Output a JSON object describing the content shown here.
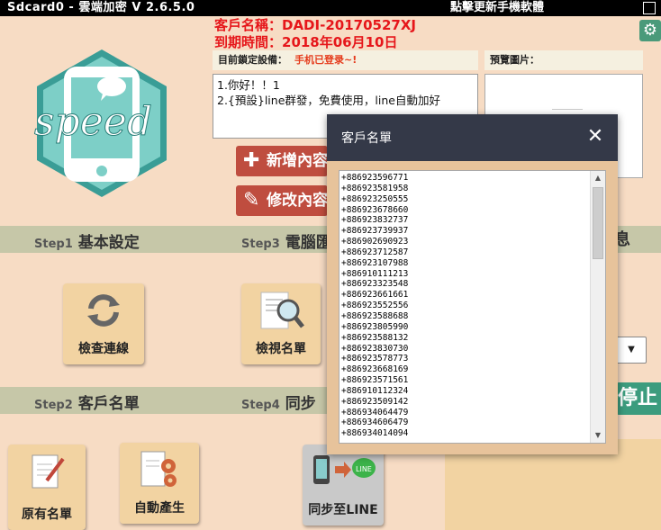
{
  "titlebar": {
    "title": "Sdcard0 - 雲端加密 V 2.6.5.0",
    "update_link": "點擊更新手機軟體"
  },
  "customer": {
    "name_line": "客戶名稱：DADI-20170527XJ",
    "expiry_line": "到期時間：2018年06月10日"
  },
  "locked_device": {
    "label": "目前鎖定設備：",
    "status": "手机已登录~!"
  },
  "preview": {
    "label": "預覽圖片："
  },
  "messages": [
    "1.你好！！1",
    "2.{預設}line群發，免費使用，line自動加好"
  ],
  "buttons": {
    "add": "新增內容",
    "edit": "修改內容",
    "stop": "停止"
  },
  "right_partial_text": "息",
  "steps": {
    "step1": {
      "num": "Step1",
      "title": "基本設定"
    },
    "step2": {
      "num": "Step2",
      "title": "客戶名單"
    },
    "step3": {
      "num": "Step3",
      "title": "電腦匯"
    },
    "step4": {
      "num": "Step4",
      "title": "同步"
    }
  },
  "tiles": {
    "check_connection": "檢查連線",
    "view_list": "檢視名單",
    "original_list": "原有名單",
    "auto_generate": "自動產生",
    "sync_line": "同步至LINE"
  },
  "dialog": {
    "title": "客戶名單",
    "close": "✕",
    "numbers": [
      "+886923596771",
      "+886923581958",
      "+886923250555",
      "+886923678660",
      "+886923832737",
      "+886923739937",
      "+886902690923",
      "+886923712587",
      "+886923107988",
      "+886910111213",
      "+886923323548",
      "+886923661661",
      "+886923552556",
      "+886923588688",
      "+886923805990",
      "+886923588132",
      "+886923830730",
      "+886923578773",
      "+886923668169",
      "+886923571561",
      "+886910112324",
      "+886923509142",
      "+886934064479",
      "+886934606479",
      "+886934014094"
    ]
  },
  "colors": {
    "accent_red": "#e6161a",
    "button_red": "#bf4d3f",
    "teal": "#3c9c7e",
    "dialog_header": "#343948",
    "band": "#c6c7a8"
  }
}
